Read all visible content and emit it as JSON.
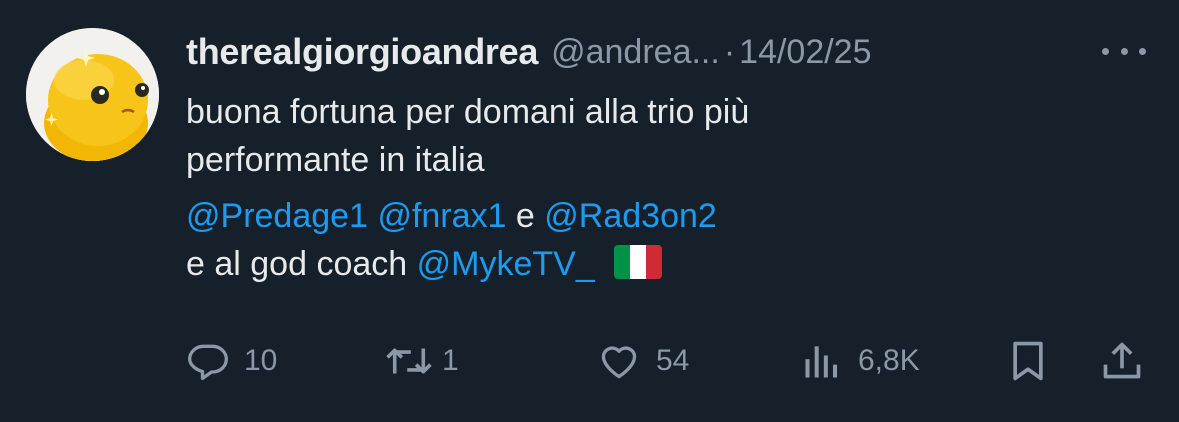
{
  "tweet": {
    "display_name": "therealgiorgioandrea",
    "handle": "@andrea...",
    "separator": "·",
    "date": "14/02/25",
    "text": {
      "line1": "buona fortuna per domani alla trio più",
      "line2": "performante in italia",
      "mention1": "@Predage1",
      "mention2": "@fnrax1",
      "conj": "e",
      "mention3": "@Rad3on2",
      "line4_prefix": "e al god coach",
      "mention4": "@MykeTV_",
      "flag": "italy-flag"
    }
  },
  "actions": {
    "replies": "10",
    "reposts": "1",
    "likes": "54",
    "views": "6,8K"
  },
  "colors": {
    "background": "#15202b",
    "text": "#e7e9ea",
    "muted": "#8b98a5",
    "link": "#1d9bf0"
  }
}
